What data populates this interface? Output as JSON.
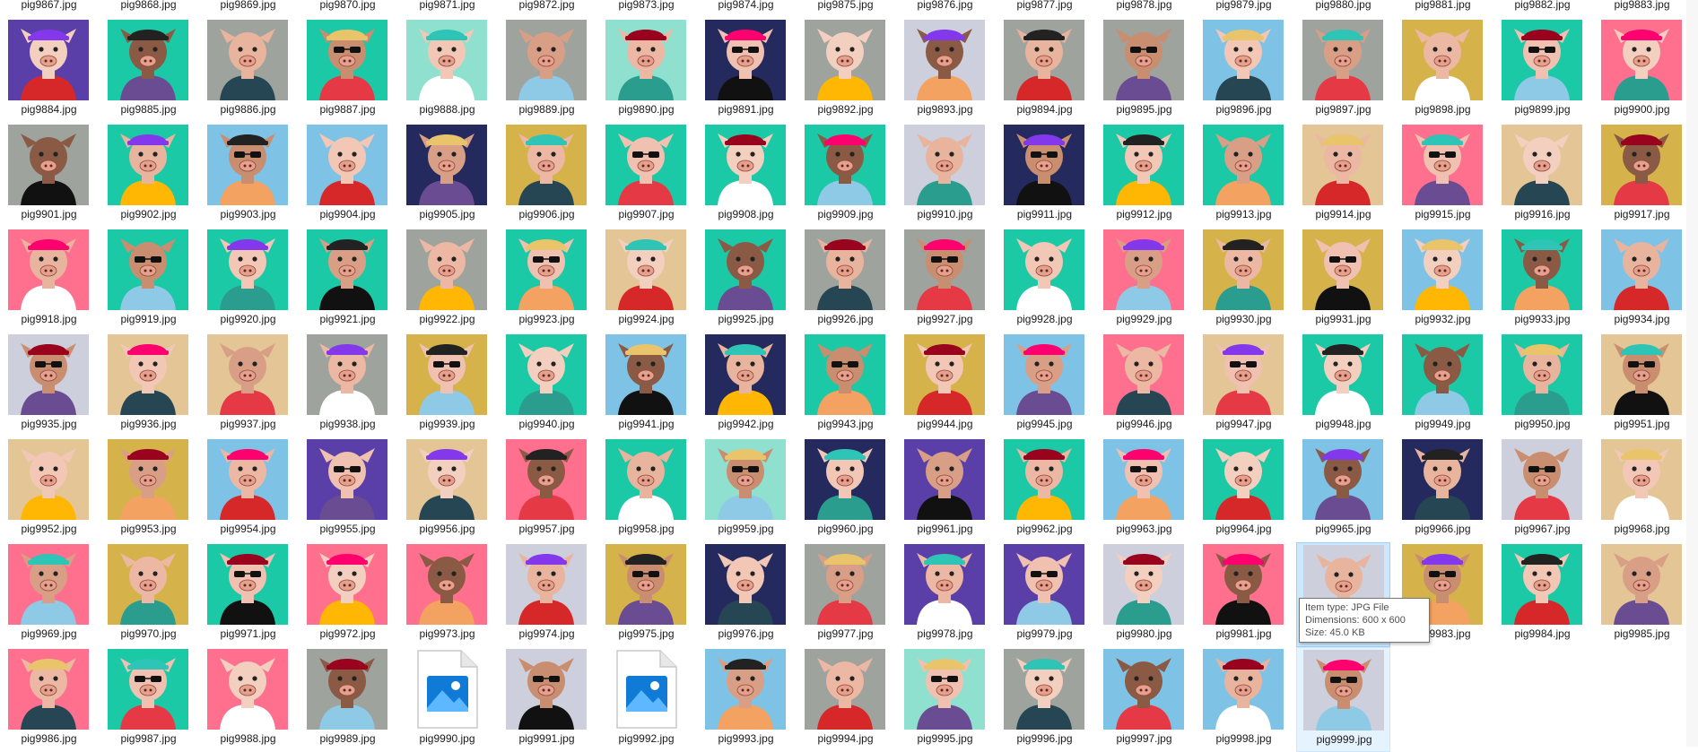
{
  "files": [
    "pig9867.jpg",
    "pig9868.jpg",
    "pig9869.jpg",
    "pig9870.jpg",
    "pig9871.jpg",
    "pig9872.jpg",
    "pig9873.jpg",
    "pig9874.jpg",
    "pig9875.jpg",
    "pig9876.jpg",
    "pig9877.jpg",
    "pig9878.jpg",
    "pig9879.jpg",
    "pig9880.jpg",
    "pig9881.jpg",
    "pig9882.jpg",
    "pig9883.jpg",
    "pig9884.jpg",
    "pig9885.jpg",
    "pig9886.jpg",
    "pig9887.jpg",
    "pig9888.jpg",
    "pig9889.jpg",
    "pig9890.jpg",
    "pig9891.jpg",
    "pig9892.jpg",
    "pig9893.jpg",
    "pig9894.jpg",
    "pig9895.jpg",
    "pig9896.jpg",
    "pig9897.jpg",
    "pig9898.jpg",
    "pig9899.jpg",
    "pig9900.jpg",
    "pig9901.jpg",
    "pig9902.jpg",
    "pig9903.jpg",
    "pig9904.jpg",
    "pig9905.jpg",
    "pig9906.jpg",
    "pig9907.jpg",
    "pig9908.jpg",
    "pig9909.jpg",
    "pig9910.jpg",
    "pig9911.jpg",
    "pig9912.jpg",
    "pig9913.jpg",
    "pig9914.jpg",
    "pig9915.jpg",
    "pig9916.jpg",
    "pig9917.jpg",
    "pig9918.jpg",
    "pig9919.jpg",
    "pig9920.jpg",
    "pig9921.jpg",
    "pig9922.jpg",
    "pig9923.jpg",
    "pig9924.jpg",
    "pig9925.jpg",
    "pig9926.jpg",
    "pig9927.jpg",
    "pig9928.jpg",
    "pig9929.jpg",
    "pig9930.jpg",
    "pig9931.jpg",
    "pig9932.jpg",
    "pig9933.jpg",
    "pig9934.jpg",
    "pig9935.jpg",
    "pig9936.jpg",
    "pig9937.jpg",
    "pig9938.jpg",
    "pig9939.jpg",
    "pig9940.jpg",
    "pig9941.jpg",
    "pig9942.jpg",
    "pig9943.jpg",
    "pig9944.jpg",
    "pig9945.jpg",
    "pig9946.jpg",
    "pig9947.jpg",
    "pig9948.jpg",
    "pig9949.jpg",
    "pig9950.jpg",
    "pig9951.jpg",
    "pig9952.jpg",
    "pig9953.jpg",
    "pig9954.jpg",
    "pig9955.jpg",
    "pig9956.jpg",
    "pig9957.jpg",
    "pig9958.jpg",
    "pig9959.jpg",
    "pig9960.jpg",
    "pig9961.jpg",
    "pig9962.jpg",
    "pig9963.jpg",
    "pig9964.jpg",
    "pig9965.jpg",
    "pig9966.jpg",
    "pig9967.jpg",
    "pig9968.jpg",
    "pig9969.jpg",
    "pig9970.jpg",
    "pig9971.jpg",
    "pig9972.jpg",
    "pig9973.jpg",
    "pig9974.jpg",
    "pig9975.jpg",
    "pig9976.jpg",
    "pig9977.jpg",
    "pig9978.jpg",
    "pig9979.jpg",
    "pig9980.jpg",
    "pig9981.jpg",
    "pig9982.jpg",
    "pig9983.jpg",
    "pig9984.jpg",
    "pig9985.jpg",
    "pig9986.jpg",
    "pig9987.jpg",
    "pig9988.jpg",
    "pig9989.jpg",
    "pig9990.jpg",
    "pig9991.jpg",
    "pig9992.jpg",
    "pig9993.jpg",
    "pig9994.jpg",
    "pig9995.jpg",
    "pig9996.jpg",
    "pig9997.jpg",
    "pig9998.jpg",
    "pig9999.jpg"
  ],
  "backgrounds": [
    "#5b3fa8",
    "#1bc9a6",
    "#9ea39e",
    "#1bc9a6",
    "#8fe0cf",
    "#9ea39e",
    "#8fe0cf",
    "#252a5e",
    "#9ea39e",
    "#cdd0dc",
    "#9ea39e",
    "#9ea39e",
    "#7ec3e6",
    "#9ea39e",
    "#d6b24a",
    "#1bc9a6",
    "#ff6f8e",
    "#5b3fa8",
    "#1bc9a6",
    "#9ea39e",
    "#1bc9a6",
    "#8fe0cf",
    "#9ea39e",
    "#8fe0cf",
    "#252a5e",
    "#9ea39e",
    "#cdd0dc",
    "#9ea39e",
    "#9ea39e",
    "#7ec3e6",
    "#9ea39e",
    "#d6b24a",
    "#1bc9a6",
    "#ff6f8e",
    "#9ea39e",
    "#1bc9a6",
    "#7ec3e6",
    "#7ec3e6",
    "#252a5e",
    "#d6b24a",
    "#1bc9a6",
    "#1bc9a6",
    "#1bc9a6",
    "#cdd0dc",
    "#252a5e",
    "#1bc9a6",
    "#1bc9a6",
    "#e3c596",
    "#ff6f8e",
    "#e3c596",
    "#d6b24a",
    "#ff6f8e",
    "#1bc9a6",
    "#1bc9a6",
    "#1bc9a6",
    "#9ea39e",
    "#1bc9a6",
    "#e3c596",
    "#1bc9a6",
    "#9ea39e",
    "#9ea39e",
    "#1bc9a6",
    "#ff6f8e",
    "#d6b24a",
    "#d6b24a",
    "#7ec3e6",
    "#1bc9a6",
    "#7ec3e6",
    "#cdd0dc",
    "#e3c596",
    "#e3c596",
    "#9ea39e",
    "#d6b24a",
    "#1bc9a6",
    "#7ec3e6",
    "#252a5e",
    "#1bc9a6",
    "#d6b24a",
    "#7ec3e6",
    "#ff6f8e",
    "#e3c596",
    "#1bc9a6",
    "#1bc9a6",
    "#1bc9a6",
    "#e3c596",
    "#e3c596",
    "#d6b24a",
    "#7ec3e6",
    "#5b3fa8",
    "#e3c596",
    "#ff6f8e",
    "#1bc9a6",
    "#8fe0cf",
    "#252a5e",
    "#5b3fa8",
    "#1bc9a6",
    "#7ec3e6",
    "#1bc9a6",
    "#7ec3e6",
    "#252a5e",
    "#cdd0dc",
    "#e3c596",
    "#ff6f8e",
    "#d6b24a",
    "#1bc9a6",
    "#ff6f8e",
    "#ff6f8e",
    "#cdd0dc",
    "#d6b24a",
    "#252a5e",
    "#9ea39e",
    "#5b3fa8",
    "#5b3fa8",
    "#cdd0dc",
    "#ff6f8e",
    "#cdd0dc",
    "#d6b24a",
    "#1bc9a6",
    "#e3c596",
    "#ff6f8e",
    "#1bc9a6",
    "#ff6f8e",
    "#9ea39e",
    "generic",
    "#cdd0dc",
    "generic",
    "#7ec3e6",
    "#9ea39e",
    "#8fe0cf",
    "#9ea39e",
    "#7ec3e6",
    "#7ec3e6",
    "#cdd0dc"
  ],
  "selected_file": "pig9982.jpg",
  "hovered_file": "pig9999.jpg",
  "tooltip": {
    "type_line": "Item type: JPG File",
    "dims_line": "Dimensions: 600 x 600",
    "size_line": "Size: 45.0 KB"
  }
}
